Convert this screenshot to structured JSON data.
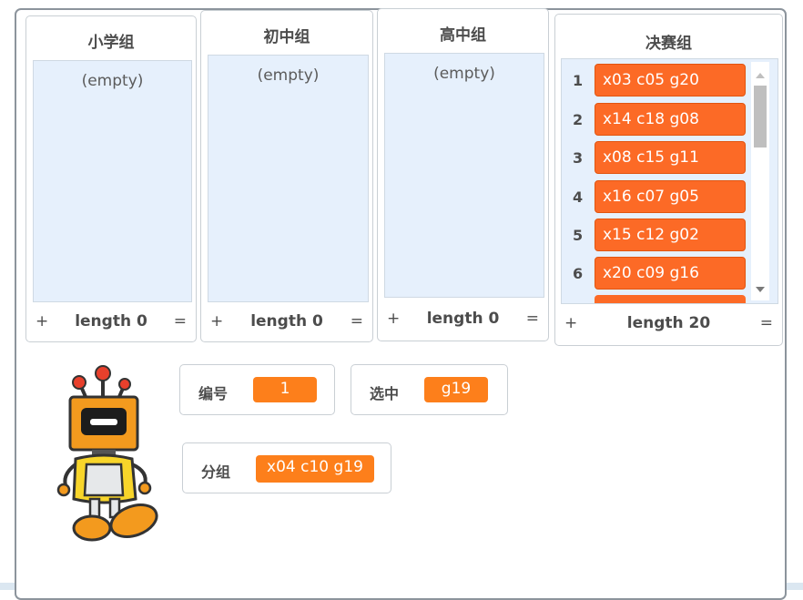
{
  "lists": [
    {
      "title": "小学组",
      "empty": "(empty)",
      "plus": "+",
      "length": "length 0",
      "eq": "="
    },
    {
      "title": "初中组",
      "empty": "(empty)",
      "plus": "+",
      "length": "length 0",
      "eq": "="
    },
    {
      "title": "高中组",
      "empty": "(empty)",
      "plus": "+",
      "length": "length 0",
      "eq": "="
    },
    {
      "title": "决赛组",
      "plus": "+",
      "length": "length 20",
      "eq": "=",
      "items": [
        {
          "index": "1",
          "value": "x03 c05 g20"
        },
        {
          "index": "2",
          "value": "x14 c18 g08"
        },
        {
          "index": "3",
          "value": "x08 c15 g11"
        },
        {
          "index": "4",
          "value": "x16 c07 g05"
        },
        {
          "index": "5",
          "value": "x15 c12 g02"
        },
        {
          "index": "6",
          "value": "x20 c09 g16"
        }
      ]
    }
  ],
  "variables": {
    "number": {
      "label": "编号",
      "value": "1"
    },
    "selected": {
      "label": "选中",
      "value": "g19"
    },
    "group": {
      "label": "分组",
      "value": "x04 c10 g19"
    }
  },
  "colors": {
    "list_item": "#fc6a26",
    "variable_value": "#fd7f1b",
    "list_background": "#e6f0fc"
  },
  "sprite": {
    "icon": "robot-sprite"
  }
}
